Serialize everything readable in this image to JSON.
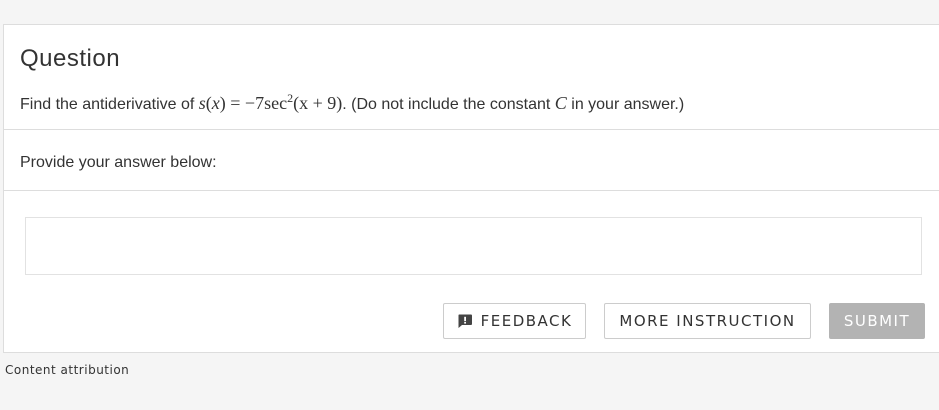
{
  "question": {
    "title": "Question",
    "text_prefix": "Find the antiderivative of ",
    "math": {
      "func": "s",
      "var": "x",
      "equals": " = −7sec",
      "exponent": "2",
      "arg": "(x + 9)"
    },
    "text_suffix_before_C": ". (Do not include the constant ",
    "constant": "C",
    "text_suffix_after_C": " in your answer.)"
  },
  "answer": {
    "prompt": "Provide your answer below:",
    "value": "",
    "placeholder": ""
  },
  "buttons": {
    "feedback_label": "FEEDBACK",
    "instruction_label": "MORE INSTRUCTION",
    "submit_label": "SUBMIT"
  },
  "icons": {
    "feedback": "feedback-icon"
  },
  "colors": {
    "submit_disabled": "#b3b3b3",
    "page_background": "#f5f5f5",
    "text": "#333333"
  },
  "footer": {
    "attribution": "Content attribution"
  }
}
